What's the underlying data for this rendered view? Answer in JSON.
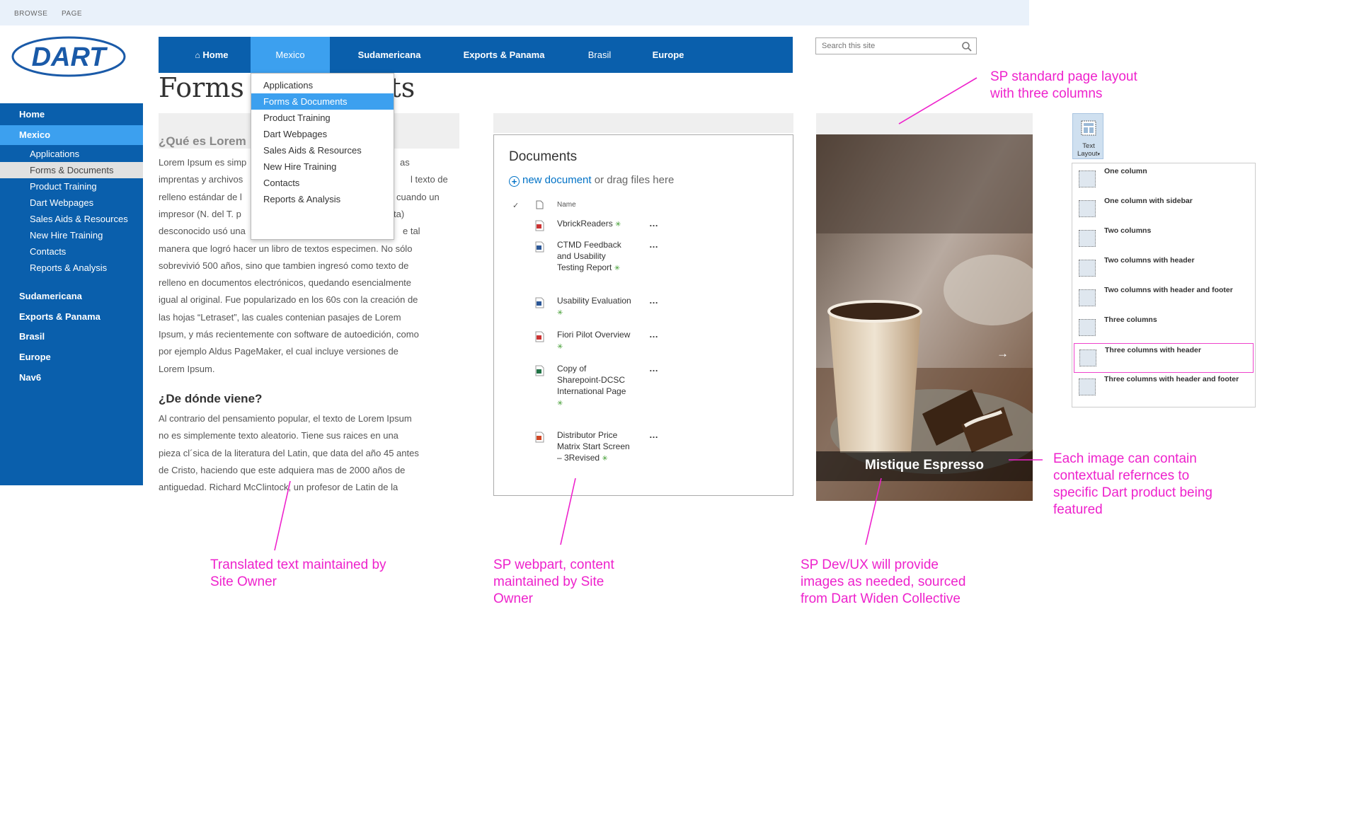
{
  "ribbon": {
    "browse": "BROWSE",
    "page": "PAGE"
  },
  "logo": {
    "text": "DART"
  },
  "left_nav": {
    "items": [
      {
        "label": "Home",
        "level": 1,
        "state": "normal"
      },
      {
        "label": "Mexico",
        "level": 1,
        "state": "active"
      },
      {
        "label": "Applications",
        "level": 2,
        "state": "normal"
      },
      {
        "label": "Forms & Documents",
        "level": 2,
        "state": "selected"
      },
      {
        "label": "Product Training",
        "level": 2,
        "state": "normal"
      },
      {
        "label": "Dart Webpages",
        "level": 2,
        "state": "normal"
      },
      {
        "label": "Sales Aids & Resources",
        "level": 2,
        "state": "normal"
      },
      {
        "label": "New Hire Training",
        "level": 2,
        "state": "normal"
      },
      {
        "label": "Contacts",
        "level": 2,
        "state": "normal"
      },
      {
        "label": "Reports & Analysis",
        "level": 2,
        "state": "normal"
      },
      {
        "label": "Sudamericana",
        "level": 1,
        "state": "normal"
      },
      {
        "label": "Exports & Panama",
        "level": 1,
        "state": "normal"
      },
      {
        "label": "Brasil",
        "level": 1,
        "state": "normal"
      },
      {
        "label": "Europe",
        "level": 1,
        "state": "normal"
      },
      {
        "label": "Nav6",
        "level": 1,
        "state": "normal"
      }
    ]
  },
  "top_nav": {
    "home_label": "Home",
    "items": [
      "Mexico",
      "Sudamericana",
      "Exports & Panama",
      "Brasil",
      "Europe"
    ]
  },
  "search": {
    "placeholder": "Search this site"
  },
  "page_title": {
    "left": "Forms ",
    "right": "nts"
  },
  "dropdown": {
    "items": [
      "Applications",
      "Forms & Documents",
      "Product Training",
      "Dart Webpages",
      "Sales Aids & Resources",
      "New Hire Training",
      "Contacts",
      "Reports & Analysis"
    ],
    "active": "Forms & Documents"
  },
  "article": {
    "heading1": "¿Qué es Lorem",
    "para1_lines": [
      "Lorem Ipsum es simp",
      "imprentas y archivos",
      "relleno estándar de l",
      "impresor (N. del T. p",
      "desconocido usó una",
      "manera que logró hacer un libro de textos especimen. No sólo",
      "sobrevivió 500 años, sino que tambien ingresó como texto de",
      "relleno en documentos electrónicos, quedando esencialmente",
      "igual al original. Fue popularizado en los 60s con la creación de",
      "las hojas “Letraset”, las cuales contenian pasajes de Lorem",
      "Ipsum, y más recientemente con software de autoedición, como",
      "por ejemplo Aldus PageMaker, el cual incluye versiones de",
      "Lorem Ipsum."
    ],
    "para1_right_fragments": [
      "as",
      "l texto de",
      "cuando un",
      "ta)",
      "e tal"
    ],
    "heading2": "¿De dónde viene?",
    "para2_lines": [
      "Al contrario del pensamiento popular, el texto de Lorem Ipsum",
      "no es simplemente texto aleatorio. Tiene sus raices en una",
      "pieza cl´sica de la literatura del Latin, que data del año 45 antes",
      "de Cristo, haciendo que este adquiera mas de 2000 años de",
      "antiguedad. Richard McClintock, un profesor de Latin de la"
    ]
  },
  "documents": {
    "title": "Documents",
    "new_link": "new document",
    "new_suffix": "or drag files here",
    "column_name": "Name",
    "checkmark": "✓",
    "new_marker": "✳",
    "ellipsis": "…",
    "files": [
      {
        "name": "VbrickReaders",
        "type": "pdf"
      },
      {
        "name": "CTMD Feedback and Usability Testing Report",
        "type": "word"
      },
      {
        "name": "Usability Evaluation",
        "type": "word"
      },
      {
        "name": "Fiori Pilot Overview",
        "type": "pdf"
      },
      {
        "name": "Copy of Sharepoint-DCSC International Page",
        "type": "excel"
      },
      {
        "name": "Distributor Price Matrix Start Screen – 3Revised",
        "type": "ppt"
      }
    ],
    "colors": {
      "link": "#0072c6",
      "new_marker": "#3c9a2c"
    }
  },
  "image_panel": {
    "caption": "Mistique Espresso",
    "next_arrow": "→"
  },
  "text_layout": {
    "button_label_line1": "Text",
    "button_label_line2": "Layout",
    "options": [
      "One column",
      "One column with sidebar",
      "Two columns",
      "Two columns with header",
      "Two columns with header and footer",
      "Three columns",
      "Three columns with header",
      "Three columns with header and footer"
    ],
    "selected": "Three columns with header"
  },
  "annotations": {
    "layout": [
      "SP standard page layout",
      "with three columns"
    ],
    "image_refs": [
      "Each image can contain",
      "contextual refernces to",
      "specific Dart product being",
      "featured"
    ],
    "translated": [
      "Translated text maintained by",
      "Site Owner"
    ],
    "webpart": [
      "SP webpart, content",
      "maintained by Site",
      "Owner"
    ],
    "images": [
      "SP Dev/UX will provide",
      "images as needed, sourced",
      "from Dart Widen Collective"
    ]
  },
  "colors": {
    "nav_blue": "#0a5fac",
    "nav_active": "#3ca0ef",
    "annotation": "#ee22cc"
  }
}
